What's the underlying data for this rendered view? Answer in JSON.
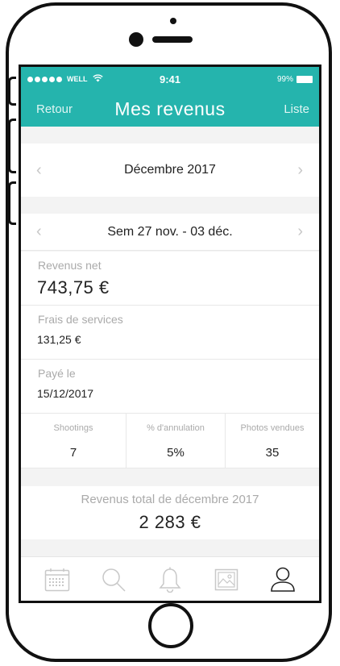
{
  "status_bar": {
    "carrier": "WELL",
    "time": "9:41",
    "battery": "99%"
  },
  "nav": {
    "back_label": "Retour",
    "title": "Mes revenus",
    "list_label": "Liste"
  },
  "month_selector": {
    "label": "Décembre 2017",
    "prev_icon": "chevron-left-icon",
    "next_icon": "chevron-right-icon"
  },
  "week_selector": {
    "label": "Sem 27 nov. - 03 déc.",
    "prev_icon": "chevron-left-icon",
    "next_icon": "chevron-right-icon"
  },
  "revenus_net": {
    "label": "Revenus net",
    "value": "743,75 €"
  },
  "frais_services": {
    "label": "Frais de services",
    "value": "131,25 €"
  },
  "paye_le": {
    "label": "Payé le",
    "value": "15/12/2017"
  },
  "stats": [
    {
      "label": "Shootings",
      "value": "7"
    },
    {
      "label": "% d'annulation",
      "value": "5%"
    },
    {
      "label": "Photos vendues",
      "value": "35"
    }
  ],
  "total": {
    "label": "Revenus total de décembre 2017",
    "value": "2 283 €"
  },
  "tabbar": {
    "items": [
      {
        "icon": "calendar-icon",
        "active": false
      },
      {
        "icon": "search-icon",
        "active": false
      },
      {
        "icon": "bell-icon",
        "active": false
      },
      {
        "icon": "photo-icon",
        "active": false
      },
      {
        "icon": "user-icon",
        "active": true
      }
    ]
  },
  "colors": {
    "accent": "#25b4ad",
    "inactive_icon": "#c8c8c8",
    "active_icon": "#222222"
  }
}
